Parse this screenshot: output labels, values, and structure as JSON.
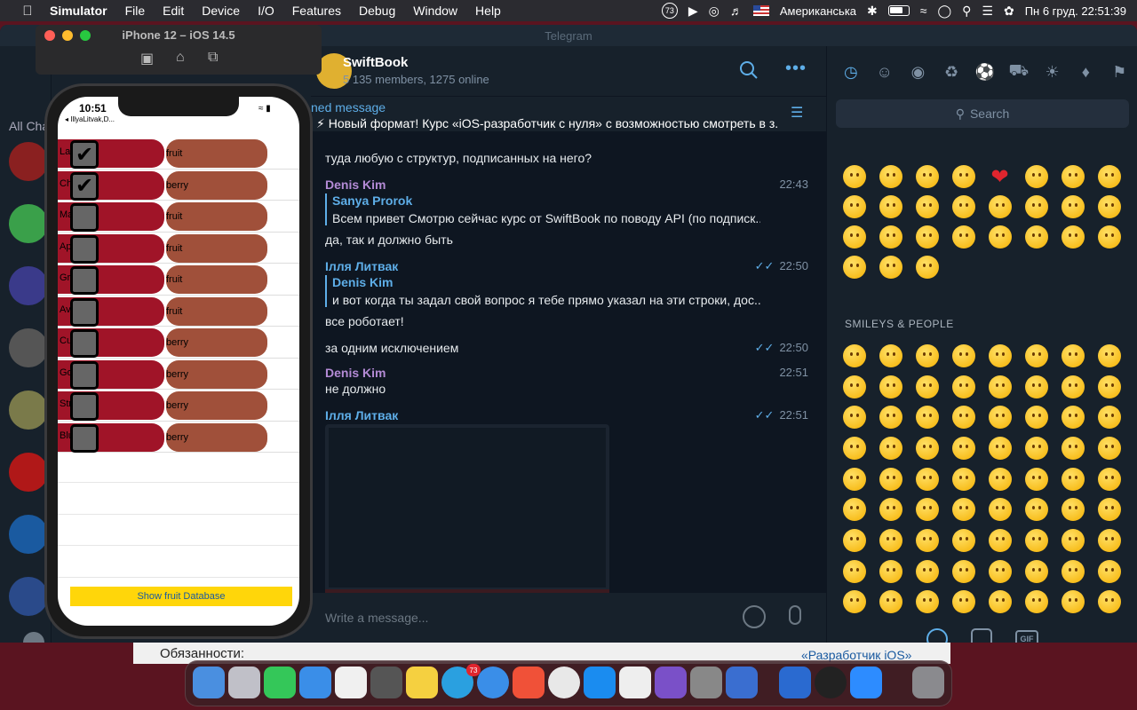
{
  "menubar": {
    "app": "Simulator",
    "items": [
      "File",
      "Edit",
      "Device",
      "I/O",
      "Features",
      "Debug",
      "Window",
      "Help"
    ],
    "badge": "73",
    "input_source": "Американська",
    "datetime": "Пн 6 груд.  22:51:39"
  },
  "telegram": {
    "window_title": "Telegram",
    "all_chats": "All Cha",
    "chat": {
      "name": "SwiftBook",
      "status": "5 135 members, 1275 online"
    },
    "pinned": {
      "label": "ned message",
      "text": "⚡ Новый формат! Курс «iOS-разработчик с нуля» с возможностью смотреть в з..."
    },
    "messages": [
      {
        "text": "туда любую с структур, подписанных на него?"
      },
      {
        "author": "Denis Kim",
        "time": "22:43",
        "reply_author": "Sanya Prorok",
        "reply_text": "Всем привет Смотрю сейчас курс от SwiftBook по поводу API (по подписк...",
        "text": "да, так и должно быть"
      },
      {
        "author": "Ілля Литвак",
        "time": "22:50",
        "reply_author": "Denis Kim",
        "reply_text": "и вот когда ты задал свой вопрос я тебе прямо указал на эти строки, дос...",
        "text": "все роботает!"
      },
      {
        "text": "за одним исключением",
        "time": "22:50"
      },
      {
        "author": "Denis Kim",
        "time": "22:51",
        "text": "не должно"
      },
      {
        "author": "Ілля Литвак",
        "time": "22:51"
      }
    ],
    "input_placeholder": "Write a message...",
    "emoji": {
      "search_placeholder": "Search",
      "section_label": "SMILEYS & PEOPLE",
      "accent": "#5eaee8"
    }
  },
  "simulator": {
    "title": "iPhone 12 – iOS 14.5"
  },
  "iphone": {
    "time": "10:51",
    "back_label": "◂ IllyaLitvak,D...",
    "rows": [
      {
        "name": "La",
        "type": "fruit",
        "checked": true
      },
      {
        "name": "Ch",
        "type": "berry",
        "checked": true
      },
      {
        "name": "Ma",
        "type": "fruit",
        "checked": false
      },
      {
        "name": "Ap",
        "type": "fruit",
        "checked": false
      },
      {
        "name": "Gr            ple",
        "type": "fruit",
        "checked": false
      },
      {
        "name": "Av",
        "type": "fruit",
        "checked": false
      },
      {
        "name": "Cu",
        "type": "berry",
        "checked": false
      },
      {
        "name": "Go           y",
        "type": "berry",
        "checked": false
      },
      {
        "name": "Str          ry",
        "type": "berry",
        "checked": false
      },
      {
        "name": "Blu",
        "type": "berry",
        "checked": false
      }
    ],
    "button_label": "Show fruit Database",
    "colors": {
      "name_pill": "#a01428",
      "type_pill": "#a0503a",
      "button": "#ffd60a"
    }
  },
  "background_page": {
    "text": "Обязанности:",
    "link": "«Разработчик iOS»"
  },
  "dock": {
    "telegram_badge": "73"
  }
}
